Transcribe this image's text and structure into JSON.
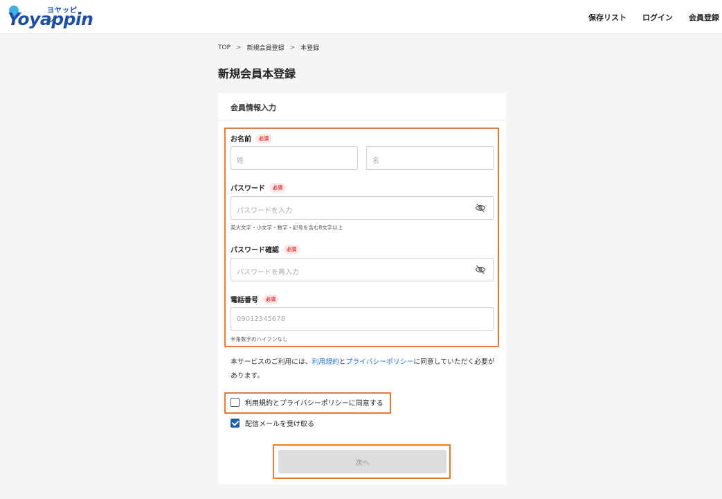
{
  "header": {
    "logo_kana": "ヨヤッピン",
    "logo_text": "oyappin",
    "nav": [
      "保存リスト",
      "ログイン",
      "会員登録"
    ]
  },
  "breadcrumb": [
    "TOP",
    "新規会員登録",
    "本登録"
  ],
  "page_title": "新規会員本登録",
  "card": {
    "title": "会員情報入力",
    "required_badge": "必須",
    "name": {
      "label": "お名前",
      "last_placeholder": "姓",
      "first_placeholder": "名"
    },
    "password": {
      "label": "パスワード",
      "placeholder": "パスワードを入力",
      "hint": "英大文字・小文字・数字・記号を含む8文字以上"
    },
    "password_confirm": {
      "label": "パスワード確認",
      "placeholder": "パスワードを再入力"
    },
    "phone": {
      "label": "電話番号",
      "placeholder": "09012345678",
      "hint": "半角数字のハイフンなし"
    },
    "notice": {
      "prefix": "本サービスのご利用には、",
      "terms_link": "利用規約",
      "and": "と",
      "privacy_link": "プライバシーポリシー",
      "suffix": "に同意していただく必要があります。"
    },
    "agree_terms": {
      "label": "利用規約とプライバシーポリシーに同意する",
      "checked": false
    },
    "receive_mail": {
      "label": "配信メールを受け取る",
      "checked": true
    },
    "next_button": "次へ"
  },
  "colors": {
    "brand": "#1f4fa3",
    "link": "#1f6fd1",
    "highlight": "#e27b33",
    "required": "#d33"
  },
  "icons": [
    "eye-off-icon",
    "checkbox-icon"
  ]
}
